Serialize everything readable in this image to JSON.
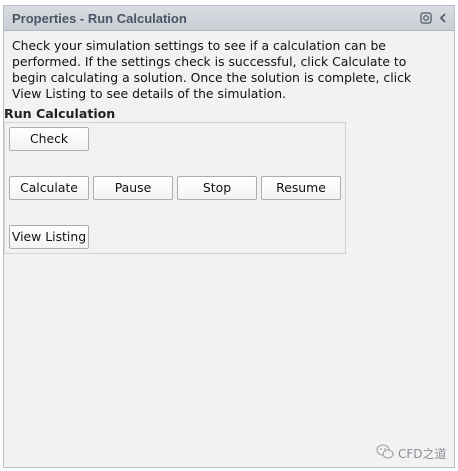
{
  "panel": {
    "title": "Properties - Run Calculation",
    "title_icons": [
      "pin-icon",
      "chevron-left-icon"
    ]
  },
  "description": "Check your simulation settings to see if a calculation can be performed. If the settings check is successful, click Calculate to begin calculating a solution. Once the solution is complete, click View Listing to see details of the simulation.",
  "run_calculation": {
    "section_title": "Run Calculation",
    "buttons": {
      "check": "Check",
      "calculate": "Calculate",
      "pause": "Pause",
      "stop": "Stop",
      "resume": "Resume",
      "view_listing": "View Listing"
    }
  },
  "watermark": {
    "icon": "wechat-icon",
    "text": "CFD之道"
  }
}
